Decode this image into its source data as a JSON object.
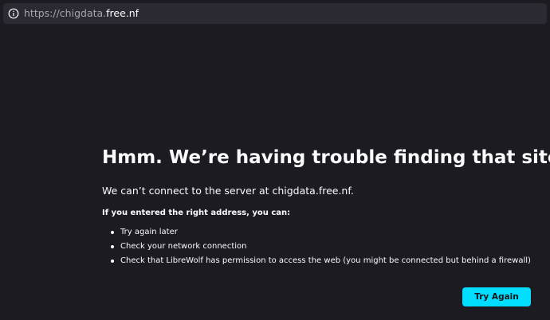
{
  "urlbar": {
    "scheme_path": "https://chigdata.",
    "domain": "free.nf",
    "info_icon": "info-icon"
  },
  "error": {
    "title": "Hmm. We’re having trouble finding that site.",
    "description": "We can’t connect to the server at chigdata.free.nf.",
    "suggestions_heading": "If you entered the right address, you can:",
    "suggestions": [
      "Try again later",
      "Check your network connection",
      "Check that LibreWolf has permission to access the web (you might be connected but behind a firewall)"
    ],
    "try_again_label": "Try Again"
  },
  "colors": {
    "background": "#1c1b22",
    "urlbar_background": "#2b2a33",
    "text": "#fbfbfe",
    "muted_text": "#a6a5ab",
    "accent": "#00ddff",
    "button_text": "#15141a"
  }
}
